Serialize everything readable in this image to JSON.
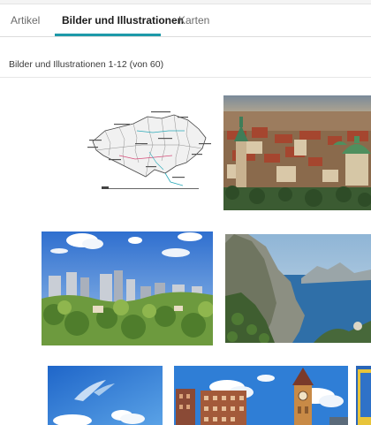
{
  "tabs": [
    {
      "label": "Artikel",
      "active": false
    },
    {
      "label": "Bilder und Illustrationen",
      "active": true
    },
    {
      "label": "Karten",
      "active": false
    }
  ],
  "results": {
    "summary": "Bilder und Illustrationen 1-12 (von 60)"
  },
  "colors": {
    "accent": "#1d99a9",
    "sky": "#3f86d6",
    "greenery": "#5e8f3a",
    "sea": "#2f6fa8"
  },
  "thumbnails": [
    {
      "subject": "map-outline"
    },
    {
      "subject": "old-town-aerial"
    },
    {
      "subject": "city-skyline-park"
    },
    {
      "subject": "coastal-cliffs-sea"
    },
    {
      "subject": "blue-sky-clouds"
    },
    {
      "subject": "towers-under-sky"
    },
    {
      "subject": "partial-yellow"
    }
  ]
}
